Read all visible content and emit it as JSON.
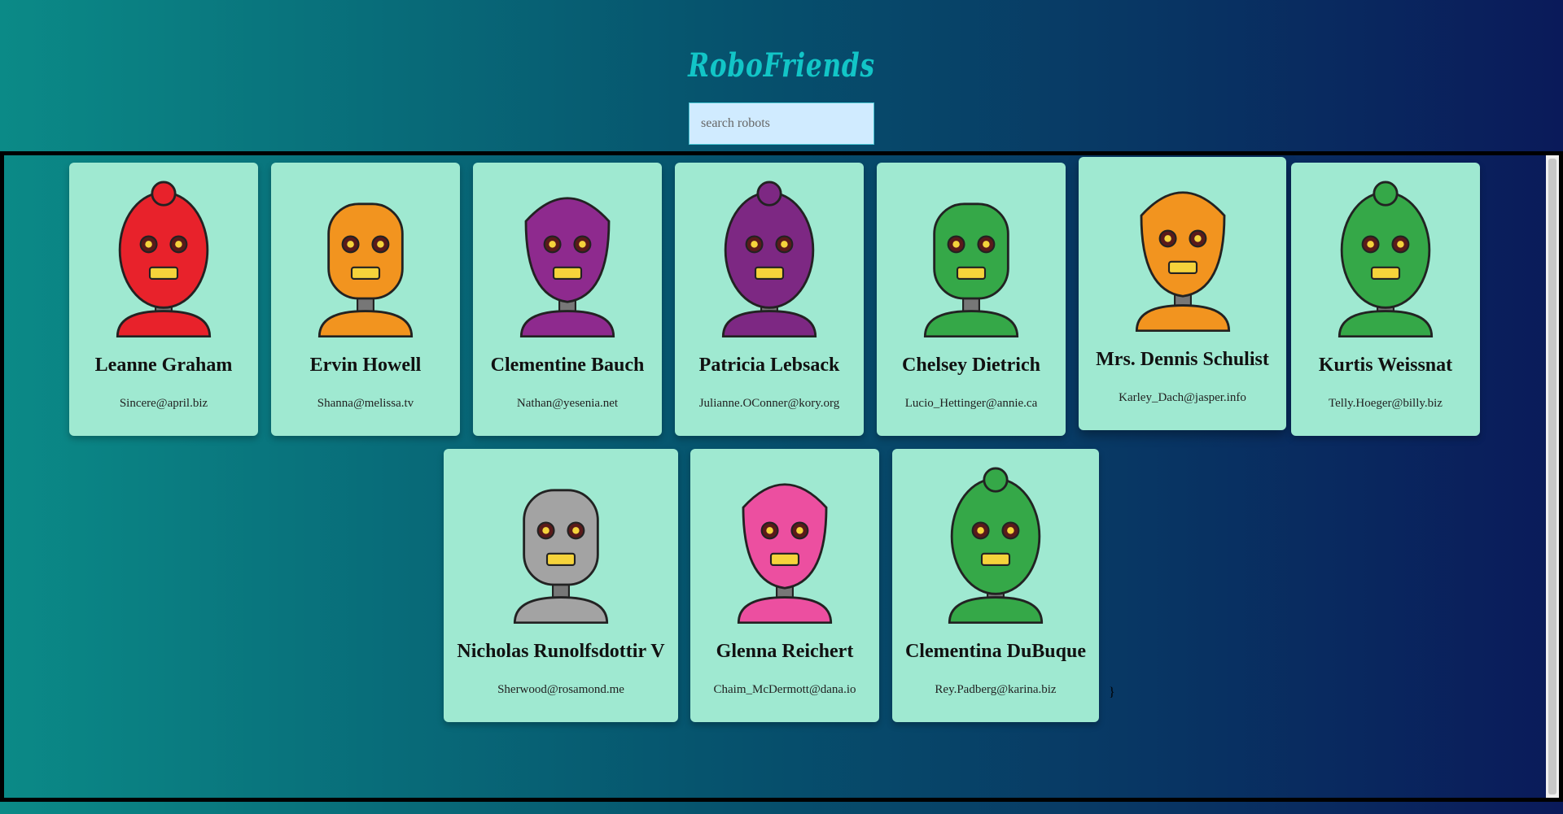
{
  "app": {
    "title": "RoboFriends"
  },
  "search": {
    "placeholder": "search robots",
    "value": ""
  },
  "robots": [
    {
      "name": "Leanne Graham",
      "email": "Sincere@april.biz",
      "color": "#e8222b",
      "avatar": "red-robot-icon"
    },
    {
      "name": "Ervin Howell",
      "email": "Shanna@melissa.tv",
      "color": "#f2941f",
      "avatar": "orange-robot-icon"
    },
    {
      "name": "Clementine Bauch",
      "email": "Nathan@yesenia.net",
      "color": "#8e2a8e",
      "avatar": "purple-robot-icon"
    },
    {
      "name": "Patricia Lebsack",
      "email": "Julianne.OConner@kory.org",
      "color": "#7d2883",
      "avatar": "purple-robot-icon"
    },
    {
      "name": "Chelsey Dietrich",
      "email": "Lucio_Hettinger@annie.ca",
      "color": "#35a848",
      "avatar": "green-robot-icon"
    },
    {
      "name": "Mrs. Dennis Schulist",
      "email": "Karley_Dach@jasper.info",
      "color": "#f2941f",
      "avatar": "orange-robot-icon"
    },
    {
      "name": "Kurtis Weissnat",
      "email": "Telly.Hoeger@billy.biz",
      "color": "#35a848",
      "avatar": "green-robot-icon"
    },
    {
      "name": "Nicholas Runolfsdottir V",
      "email": "Sherwood@rosamond.me",
      "color": "#a3a3a3",
      "avatar": "gray-robot-icon"
    },
    {
      "name": "Glenna Reichert",
      "email": "Chaim_McDermott@dana.io",
      "color": "#ec4fa0",
      "avatar": "pink-robot-icon"
    },
    {
      "name": "Clementina DuBuque",
      "email": "Rey.Padberg@karina.biz",
      "color": "#35a848",
      "avatar": "green-robot-icon"
    }
  ],
  "stray_text": "}"
}
